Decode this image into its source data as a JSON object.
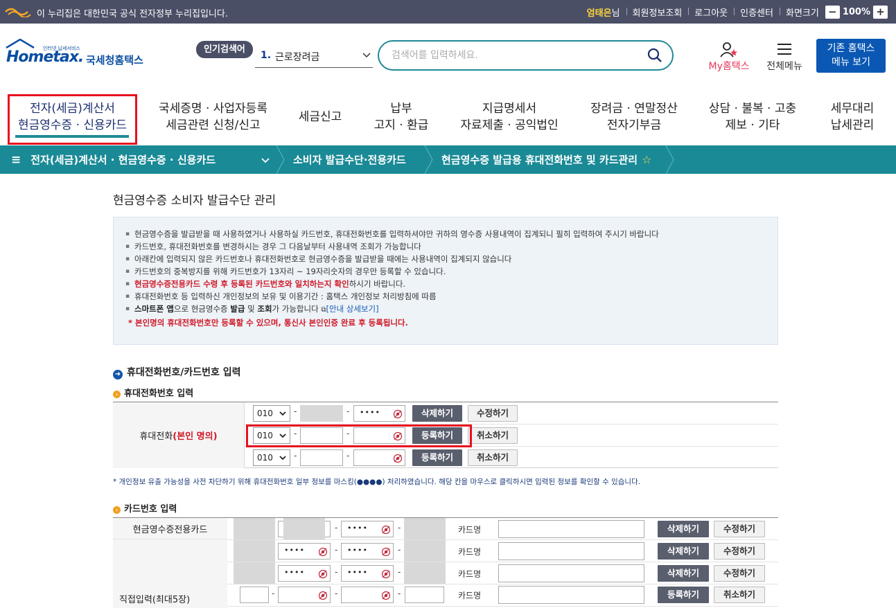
{
  "topbar": {
    "gov_notice": "이 누리집은 대한민국 공식 전자정부 누리집입니다.",
    "user_name": "엄태은",
    "user_suffix": "님",
    "links": [
      "회원정보조회",
      "로그아웃",
      "인증센터",
      "화면크기"
    ],
    "zoom_minus": "−",
    "zoom_value": "100%",
    "zoom_plus": "+"
  },
  "header": {
    "logo_tagline": "인터넷 납세서비스",
    "logo_home": "Hometax.",
    "logo_name": "국세청홈택스",
    "popular_badge": "인기검색어",
    "popular_rank": "1.",
    "popular_term": "근로장려금",
    "search_placeholder": "검색어를 입력하세요.",
    "myhome_label": "My홈택스",
    "allmenu_label": "전체메뉴",
    "oldmenu_line1": "기존 홈택스",
    "oldmenu_line2": "메뉴 보기"
  },
  "gnb": [
    {
      "line1": "전자(세금)계산서",
      "line2": "현금영수증 · 신용카드"
    },
    {
      "line1": "국세증명 · 사업자등록",
      "line2": "세금관련 신청/신고"
    },
    {
      "line1": "세금신고",
      "line2": ""
    },
    {
      "line1": "납부",
      "line2": "고지 · 환급"
    },
    {
      "line1": "지급명세서",
      "line2": "자료제출 · 공익법인"
    },
    {
      "line1": "장려금 · 연말정산",
      "line2": "전자기부금"
    },
    {
      "line1": "상담 · 불복 · 고충",
      "line2": "제보 · 기타"
    },
    {
      "line1": "세무대리",
      "line2": "납세관리"
    }
  ],
  "breadcrumb": {
    "menu_icon": "≡",
    "level1": "전자(세금)계산서 · 현금영수증 · 신용카드",
    "level2": "소비자 발급수단·전용카드",
    "level3": "현금영수증 발급용 휴대전화번호 및 카드관리",
    "star": "☆"
  },
  "page": {
    "title": "현금영수증 소비자 발급수단 관리",
    "info": [
      "현금영수증을 발급받을 때 사용하였거나 사용하실 카드번호, 휴대전화번호를 입력하셔야만 귀하의 영수증 사용내역이 집계되니 필히 입력하여 주시기 바랍니다",
      "카드번호, 휴대전화번호를 변경하시는 경우 그 다음날부터 사용내역 조회가 가능합니다",
      "아래칸에 입력되지 않은 카드번호나 휴대전화번호로 현금영수증을 발급받을 때에는 사용내역이 집계되지 않습니다",
      "카드번호의 중복방지를 위해 카드번호가 13자리 ~ 19자리숫자의 경우만 등록할 수 있습니다.",
      "현금영수증전용카드 수령 후 등록된 카드번호와 일치하는지 확인",
      "휴대전화번호 등 입력하신 개인정보의 보유 및 이용기간 : 홈택스 개인정보 처리방침에 따름"
    ],
    "info_red_suffix": "하시기 바랍니다.",
    "info_app_bold1": "스마트폰 앱",
    "info_app_mid1": "으로 현금영수증 ",
    "info_app_bold2": "발급",
    "info_app_mid2": " 및 ",
    "info_app_bold3": "조회",
    "info_app_mid3": "가 가능합니다 ",
    "info_app_link": "[안내 상세보기]",
    "info_red_notice": "* 본인명의 휴대전화번호만 등록할 수 있으며, 통신사 본인인증 완료 후 등록됩니다.",
    "phone_section_title": "휴대전화번호/카드번호 입력",
    "phone_sub_title": "휴대전화번호 입력",
    "phone_label": "휴대전화",
    "phone_label_red": "(본인 명의)",
    "phone_rows": [
      {
        "prefix": "010",
        "mid": "",
        "last": "••••",
        "btn1": "삭제하기",
        "btn2": "수정하기"
      },
      {
        "prefix": "010",
        "mid": "",
        "last": "",
        "btn1": "등록하기",
        "btn2": "취소하기"
      },
      {
        "prefix": "010",
        "mid": "",
        "last": "",
        "btn1": "등록하기",
        "btn2": "취소하기"
      }
    ],
    "mask_notice": "* 개인정보 유출 가능성을 사전 차단하기 위해 휴대전화번호 일부 정보를 마스킹(●●●●) 처리하였습니다. 해당 칸을 마우스로 클릭하시면 입력된 정보를 확인할 수 있습니다.",
    "card_sub_title": "카드번호 입력",
    "card_label1": "현금영수증전용카드",
    "card_label2": "직접입력(최대5장)",
    "card_name_label": "카드명",
    "card_rows": [
      {
        "f2": "",
        "f3": "••••",
        "btn1": "삭제하기",
        "btn2": "수정하기"
      },
      {
        "f2": "••••",
        "f3": "••••",
        "btn1": "삭제하기",
        "btn2": "수정하기"
      },
      {
        "f2": "••••",
        "f3": "••••",
        "btn1": "삭제하기",
        "btn2": "수정하기"
      },
      {
        "f2": "",
        "f3": "",
        "btn1": "등록하기",
        "btn2": "취소하기"
      }
    ]
  },
  "colors": {
    "topbar_bg": "#4a4f66",
    "teal": "#1a8a96",
    "highlight_red": "#e8101f",
    "navy_button": "#0b58b4"
  }
}
